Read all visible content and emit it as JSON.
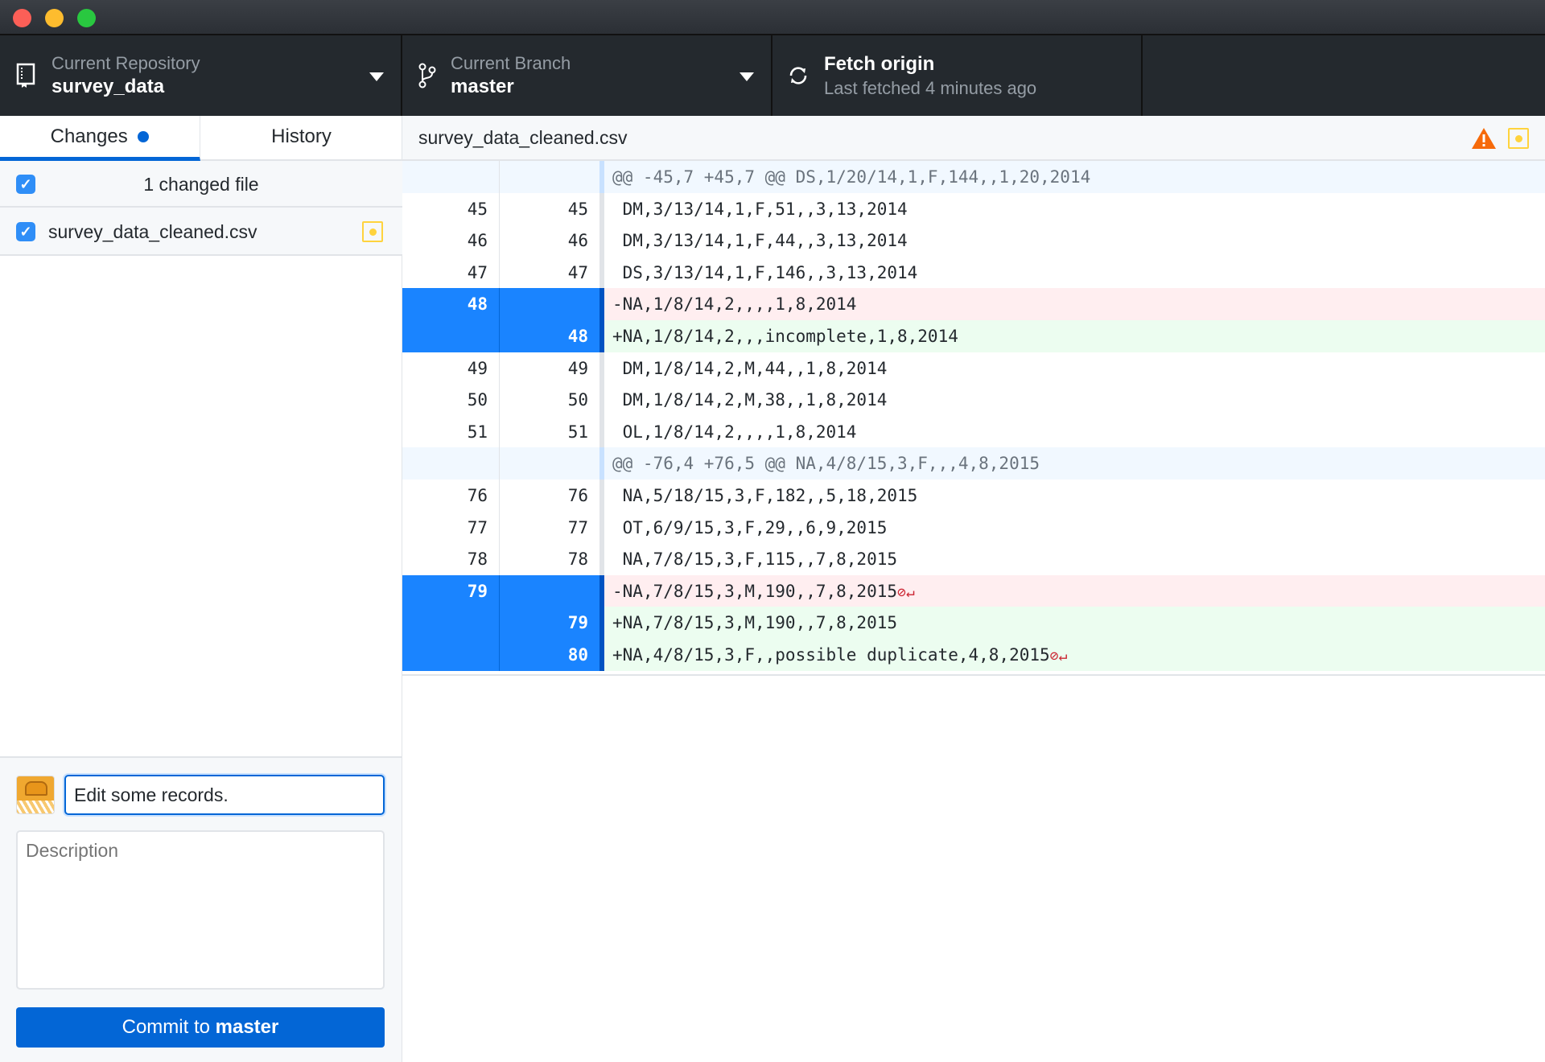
{
  "window": {
    "controls": [
      "close",
      "minimize",
      "maximize"
    ]
  },
  "toolbar": {
    "repository": {
      "label": "Current Repository",
      "value": "survey_data"
    },
    "branch": {
      "label": "Current Branch",
      "value": "master"
    },
    "fetch": {
      "label": "Fetch origin",
      "status": "Last fetched 4 minutes ago"
    }
  },
  "sidebar": {
    "tabs": [
      {
        "label": "Changes",
        "active": true,
        "has_changes_dot": true
      },
      {
        "label": "History",
        "active": false
      }
    ],
    "changes_header": "1 changed file",
    "files": [
      {
        "name": "survey_data_cleaned.csv",
        "checked": true,
        "status": "modified"
      }
    ],
    "commit": {
      "summary_value": "Edit some records.",
      "description_placeholder": "Description",
      "button_prefix": "Commit to ",
      "button_branch": "master"
    }
  },
  "diff": {
    "file_name": "survey_data_cleaned.csv",
    "colors": {
      "selected_gutter": "#1a84ff",
      "deleted_bg": "#ffeef0",
      "added_bg": "#ecfdf0",
      "hunk_bg": "#f1f8ff",
      "warning": "#f66a0a"
    },
    "rows": [
      {
        "type": "hunk",
        "old": "",
        "new": "",
        "text": "@@ -45,7 +45,7 @@ DS,1/20/14,1,F,144,,1,20,2014"
      },
      {
        "type": "context",
        "old": "45",
        "new": "45",
        "text": " DM,3/13/14,1,F,51,,3,13,2014"
      },
      {
        "type": "context",
        "old": "46",
        "new": "46",
        "text": " DM,3/13/14,1,F,44,,3,13,2014"
      },
      {
        "type": "context",
        "old": "47",
        "new": "47",
        "text": " DS,3/13/14,1,F,146,,3,13,2014"
      },
      {
        "type": "del",
        "selected": true,
        "old": "48",
        "new": "",
        "text": "-NA,1/8/14,2,,,,1,8,2014"
      },
      {
        "type": "add",
        "selected": true,
        "old": "",
        "new": "48",
        "text": "+NA,1/8/14,2,,,incomplete,1,8,2014"
      },
      {
        "type": "context",
        "old": "49",
        "new": "49",
        "text": " DM,1/8/14,2,M,44,,1,8,2014"
      },
      {
        "type": "context",
        "old": "50",
        "new": "50",
        "text": " DM,1/8/14,2,M,38,,1,8,2014"
      },
      {
        "type": "context",
        "old": "51",
        "new": "51",
        "text": " OL,1/8/14,2,,,,1,8,2014"
      },
      {
        "type": "hunk",
        "old": "",
        "new": "",
        "text": "@@ -76,4 +76,5 @@ NA,4/8/15,3,F,,,4,8,2015"
      },
      {
        "type": "context",
        "old": "76",
        "new": "76",
        "text": " NA,5/18/15,3,F,182,,5,18,2015"
      },
      {
        "type": "context",
        "old": "77",
        "new": "77",
        "text": " OT,6/9/15,3,F,29,,6,9,2015"
      },
      {
        "type": "context",
        "old": "78",
        "new": "78",
        "text": " NA,7/8/15,3,F,115,,7,8,2015"
      },
      {
        "type": "del",
        "selected": true,
        "old": "79",
        "new": "",
        "text": "-NA,7/8/15,3,M,190,,7,8,2015",
        "no_newline": true
      },
      {
        "type": "add",
        "selected": true,
        "old": "",
        "new": "79",
        "text": "+NA,7/8/15,3,M,190,,7,8,2015"
      },
      {
        "type": "add",
        "selected": true,
        "old": "",
        "new": "80",
        "text": "+NA,4/8/15,3,F,,possible duplicate,4,8,2015",
        "no_newline": true
      }
    ],
    "no_newline_icon": "⊘↵"
  }
}
